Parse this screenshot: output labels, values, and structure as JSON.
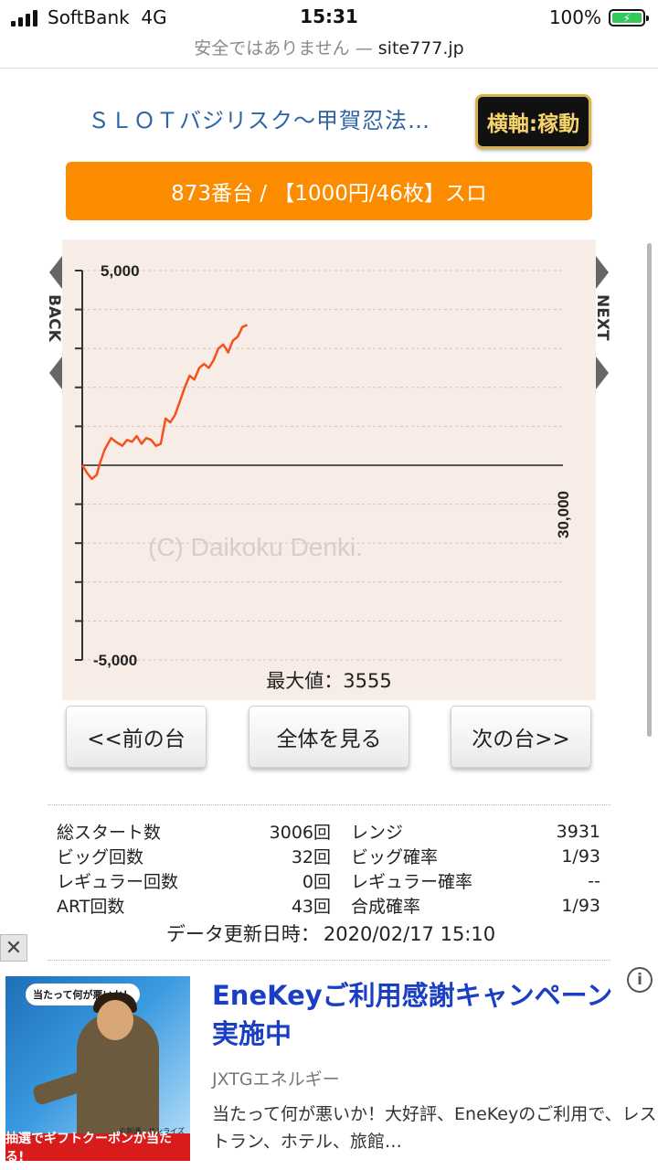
{
  "status_bar": {
    "carrier": "SoftBank",
    "network": "4G",
    "time": "15:31",
    "battery": "100%",
    "battery_level": 1.0
  },
  "browser": {
    "security": "安全ではありません —",
    "host": "site777.jp"
  },
  "header": {
    "title": "ＳＬＯＴバジリスク〜甲賀忍法…",
    "axis_toggle": "横軸:稼動",
    "machine": "873番台 / 【1000円/46枚】スロ"
  },
  "graph": {
    "back_label": "BACK",
    "next_label": "NEXT",
    "watermark": "(C) Daikoku Denki.",
    "max_label": "最大値：3555",
    "colors": {
      "background": "#f7ece6",
      "line": "#f4511e"
    }
  },
  "chart_data": {
    "type": "line",
    "y_ticks": [
      "5,000",
      "-5,000"
    ],
    "x_ticks": [
      "30,000"
    ],
    "ylim": [
      -5000,
      5000
    ],
    "xlim": [
      0,
      30000
    ],
    "grid": true,
    "series": [
      {
        "x": [
          0,
          300,
          600,
          900,
          1100,
          1400,
          1800,
          2100,
          2500,
          2800,
          3100,
          3400,
          3700,
          4000,
          4300,
          4600,
          4900,
          5200,
          5500,
          5800,
          6100,
          6400,
          6700,
          7000,
          7300,
          7600,
          7900,
          8200,
          8500,
          8800,
          9100,
          9400,
          9700,
          10000,
          10300
        ],
        "y": [
          0,
          -200,
          -350,
          -250,
          50,
          400,
          700,
          600,
          500,
          650,
          600,
          750,
          550,
          700,
          650,
          500,
          550,
          1200,
          1100,
          1300,
          1650,
          2000,
          2300,
          2200,
          2500,
          2600,
          2500,
          2700,
          3000,
          3100,
          2900,
          3200,
          3300,
          3555,
          3600
        ]
      }
    ]
  },
  "buttons": {
    "prev": "<<前の台",
    "all": "全体を見る",
    "next": "次の台>>"
  },
  "stats": [
    {
      "label1": "総スタート数",
      "value1": "3006回",
      "label2": "レンジ",
      "value2": "3931"
    },
    {
      "label1": "ビッグ回数",
      "value1": "32回",
      "label2": "ビッグ確率",
      "value2": "1/93"
    },
    {
      "label1": "レギュラー回数",
      "value1": "0回",
      "label2": "レギュラー確率",
      "value2": "--"
    },
    {
      "label1": "ART回数",
      "value1": "43回",
      "label2": "合成確率",
      "value2": "1/93"
    }
  ],
  "updated": {
    "label": "データ更新日時：",
    "value": "2020/02/17 15:10"
  },
  "ad": {
    "close_icon": "close-icon",
    "info_icon": "info-icon",
    "bubble": "当たって何が悪いか！",
    "credit": "©創通・サンライズ",
    "banner": "抽選でギフトクーポンが当たる!",
    "title": "EneKeyご利用感謝キャンペーン実施中",
    "advertiser": "JXTGエネルギー",
    "description": "当たって何が悪いか！大好評、EneKeyのご利用で、レストラン、ホテル、旅館…"
  }
}
